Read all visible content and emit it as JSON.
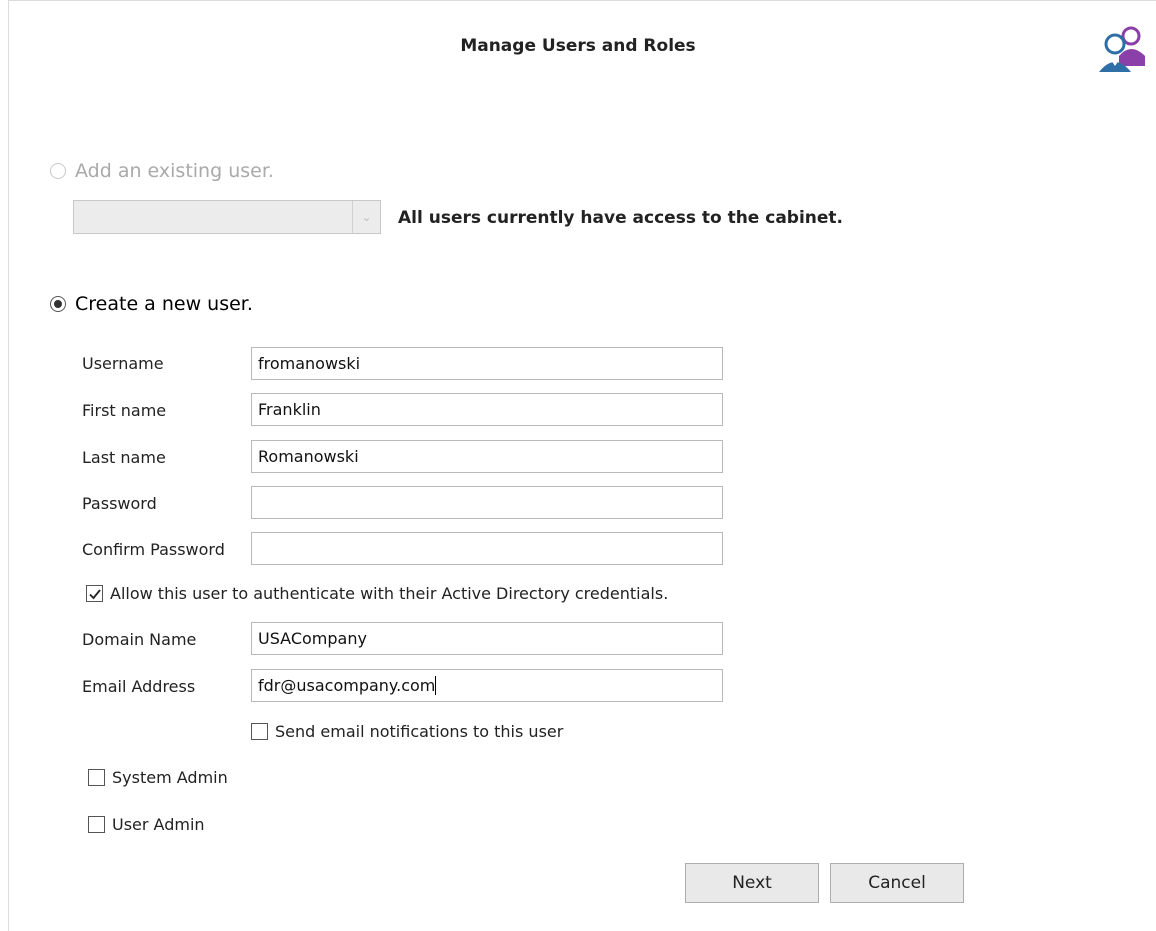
{
  "dialog": {
    "title": "Manage Users and Roles",
    "logo_icon": "users-roles-icon"
  },
  "existing_user": {
    "radio_label": "Add an existing user.",
    "selected": false,
    "enabled": false,
    "dropdown_value": "",
    "note": "All users currently have access to the cabinet."
  },
  "new_user": {
    "radio_label": "Create a new user.",
    "selected": true,
    "fields": {
      "username": {
        "label": "Username",
        "value": "fromanowski"
      },
      "first_name": {
        "label": "First name",
        "value": "Franklin"
      },
      "last_name": {
        "label": "Last name",
        "value": "Romanowski"
      },
      "password": {
        "label": "Password",
        "value": ""
      },
      "confirm_password": {
        "label": "Confirm Password",
        "value": ""
      },
      "domain_name": {
        "label": "Domain Name",
        "value": "USACompany"
      },
      "email": {
        "label": "Email Address",
        "value": "fdr@usacompany.com"
      }
    },
    "ad_auth": {
      "label": "Allow this user to authenticate with their Active Directory credentials.",
      "checked": true
    },
    "email_notifications": {
      "label": "Send email notifications to this user",
      "checked": false
    },
    "roles": {
      "system_admin": {
        "label": "System Admin",
        "checked": false
      },
      "user_admin": {
        "label": "User Admin",
        "checked": false
      }
    }
  },
  "buttons": {
    "next": "Next",
    "cancel": "Cancel"
  },
  "colors": {
    "icon_blue": "#2f6fa8",
    "icon_purple": "#8b3fa8"
  }
}
